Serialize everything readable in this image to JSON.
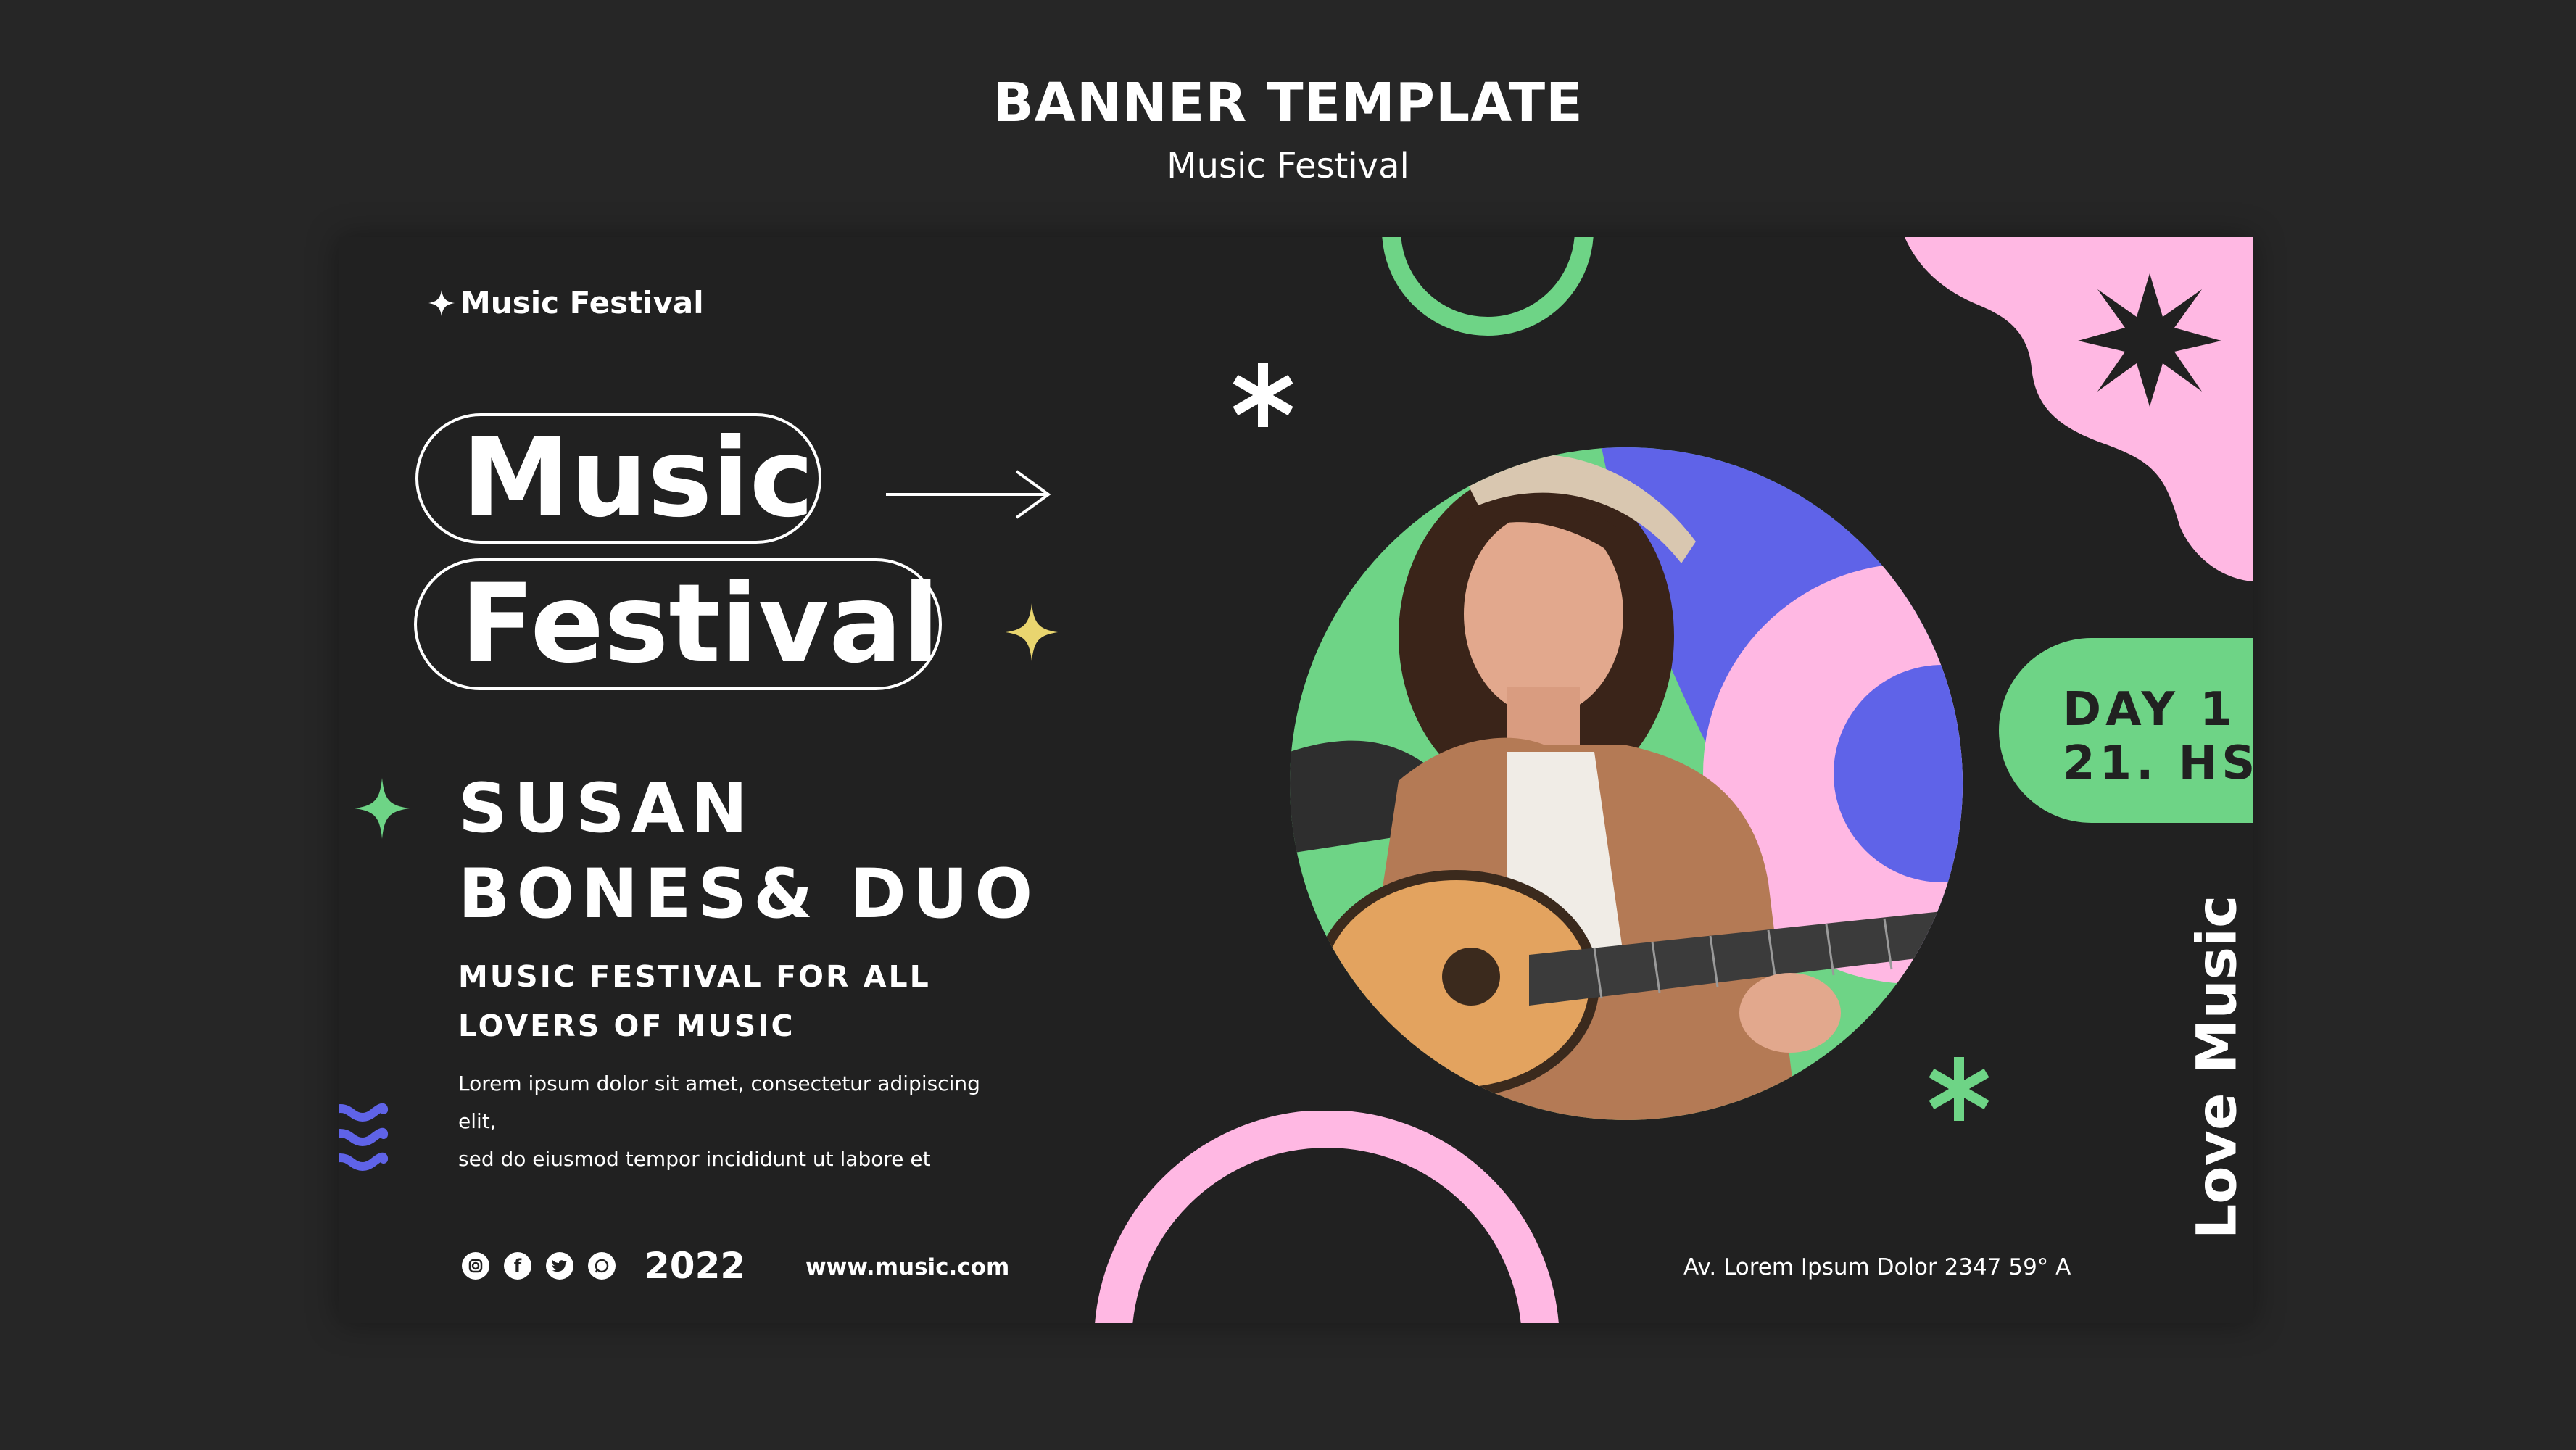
{
  "header": {
    "title": "BANNER TEMPLATE",
    "subtitle": "Music Festival"
  },
  "banner": {
    "brand": "Music Festival",
    "title_line1": "Music",
    "title_line2": "Festival",
    "artist_line1": "SUSAN",
    "artist_line2": "BONES& DUO",
    "tagline_line1": "MUSIC FESTIVAL FOR ALL",
    "tagline_line2": "LOVERS OF MUSIC",
    "lorem_line1": "Lorem ipsum dolor sit amet, consectetur adipiscing elit,",
    "lorem_line2": "sed do eiusmod tempor incididunt ut labore et",
    "year": "2022",
    "website": "www.music.com",
    "address": "Av. Lorem Ipsum Dolor 2347 59° A",
    "day_line1": "DAY 1",
    "day_line2": "21. HS",
    "vertical_text": "Love Music",
    "social_icons": [
      "instagram-icon",
      "facebook-icon",
      "twitter-icon",
      "whatsapp-icon"
    ]
  },
  "colors": {
    "background": "#262626",
    "banner": "#212121",
    "green": "#6ed486",
    "pink": "#ffb8e3",
    "blue": "#5f63e8",
    "yellow": "#e9d56f"
  }
}
